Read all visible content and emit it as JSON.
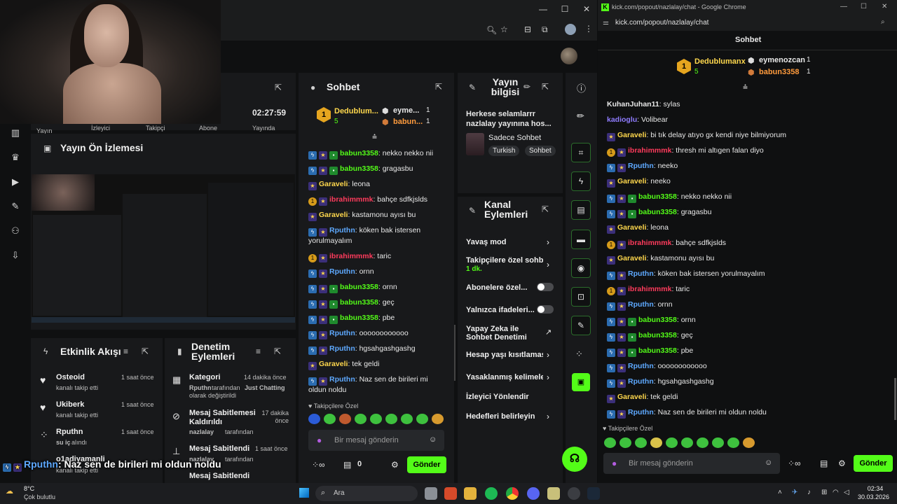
{
  "left_window": {
    "tab_title": "",
    "address": ""
  },
  "stats": {
    "timer": "02:27:59",
    "labels": [
      "Yayın",
      "İzleyici",
      "Takipçi",
      "Abone",
      "Yayında"
    ]
  },
  "preview": {
    "title": "Yayın Ön İzlemesi"
  },
  "activity": {
    "title": "Etkinlik Akışı",
    "items": [
      {
        "name": "Osteoid",
        "sub": "kanalı takip etti",
        "time": "1 saat önce"
      },
      {
        "name": "Ukiberk",
        "sub": "kanalı takip etti",
        "time": "1 saat önce"
      },
      {
        "name": "Rputhn",
        "sub_green": "su iç",
        "sub": "alındı",
        "time": "1 saat önce"
      },
      {
        "name": "o1adiyamanli",
        "sub": "kanalı takip etti",
        "time": ""
      }
    ]
  },
  "moderation": {
    "title": "Denetim Eylemleri",
    "items": [
      {
        "name": "Kategori",
        "time": "14 dakika önce",
        "user": "Rputhn",
        "mid": "tarafından",
        "target": "Just Chatting",
        "sub": "olarak değiştirildi"
      },
      {
        "name": "Mesaj Sabitlemesi Kaldırıldı",
        "time": "17 dakika önce",
        "user": "nazlalay",
        "sub": "tarafından"
      },
      {
        "name": "Mesaj Sabitlendi",
        "time": "1 saat önce",
        "user": "nazlalay",
        "sub": "tarafından"
      },
      {
        "name": "Mesaj Sabitlendi",
        "time": "",
        "user": "",
        "sub": ""
      }
    ]
  },
  "chat": {
    "title": "Sohbet",
    "leader1": {
      "name": "Dedublum...",
      "count": "5"
    },
    "leader2": {
      "name": "eyme...",
      "count": "1"
    },
    "leader3": {
      "name": "babun...",
      "count": "1"
    },
    "messages": [
      {
        "badges": [
          "bolt",
          "star",
          "sub"
        ],
        "user": "babun3358",
        "color": "green",
        "text": "nekko nekko nii"
      },
      {
        "badges": [
          "bolt",
          "star",
          "sub"
        ],
        "user": "babun3358",
        "color": "green",
        "text": "gragasbu"
      },
      {
        "badges": [
          "star"
        ],
        "user": "Garaveli",
        "color": "yellow",
        "text": "leona"
      },
      {
        "badges": [
          "gold",
          "star"
        ],
        "user": "ibrahimmmk",
        "color": "red",
        "text": "bahçe sdfkjslds"
      },
      {
        "badges": [
          "star"
        ],
        "user": "Garaveli",
        "color": "yellow",
        "text": "kastamonu ayısı bu"
      },
      {
        "badges": [
          "bolt",
          "star"
        ],
        "user": "Rputhn",
        "color": "blue",
        "text": "köken bak istersen",
        "text2": "yorulmayalım"
      },
      {
        "badges": [
          "gold",
          "star"
        ],
        "user": "ibrahimmmk",
        "color": "red",
        "text": "taric"
      },
      {
        "badges": [
          "bolt",
          "star"
        ],
        "user": "Rputhn",
        "color": "blue",
        "text": "ornn"
      },
      {
        "badges": [
          "bolt",
          "star",
          "sub"
        ],
        "user": "babun3358",
        "color": "green",
        "text": "ornn"
      },
      {
        "badges": [
          "bolt",
          "star",
          "sub"
        ],
        "user": "babun3358",
        "color": "green",
        "text": "geç"
      },
      {
        "badges": [
          "bolt",
          "star",
          "sub"
        ],
        "user": "babun3358",
        "color": "green",
        "text": "pbe"
      },
      {
        "badges": [
          "bolt",
          "star"
        ],
        "user": "Rputhn",
        "color": "blue",
        "text": "oooooooooooo"
      },
      {
        "badges": [
          "bolt",
          "star"
        ],
        "user": "Rputhn",
        "color": "blue",
        "text": "hgsahgashgashg"
      },
      {
        "badges": [
          "star"
        ],
        "user": "Garaveli",
        "color": "yellow",
        "text": "tek geldi"
      },
      {
        "badges": [
          "bolt",
          "star"
        ],
        "user": "Rputhn",
        "color": "blue",
        "text": "Naz sen de birileri mi",
        "text2": "oldun noldu"
      }
    ],
    "followers_label": "Takipçilere Özel",
    "input_placeholder": "Bir mesaj gönderin",
    "send_label": "Gönder",
    "count": "0"
  },
  "stream_info": {
    "title": "Yayın bilgisi",
    "desc": "Herkese selamlarrr nazlalay yayınına hos...",
    "category": "Sadece Sohbet",
    "tags": [
      "Turkish",
      "Sohbet"
    ]
  },
  "channel_actions": {
    "title": "Kanal Eylemleri",
    "rows": [
      {
        "label": "Yavaş mod",
        "type": "chevron"
      },
      {
        "label": "Takipçilere özel sohbe",
        "sub": "1 dk.",
        "type": "chevron"
      },
      {
        "label": "Abonelere özel...",
        "type": "toggle"
      },
      {
        "label": "Yalnızca ifadeleri...",
        "type": "toggle"
      },
      {
        "label": "Yapay Zeka ile Sohbet Denetimi",
        "type": "external"
      },
      {
        "label": "Hesap yaşı kısıtlaması",
        "type": "chevron"
      },
      {
        "label": "Yasaklanmış kelimeler",
        "type": "chevron"
      },
      {
        "label": "İzleyici Yönlendir",
        "type": "none"
      },
      {
        "label": "Hedefleri belirleyin",
        "type": "chevron"
      }
    ]
  },
  "overlay_message": {
    "user": "Rputhn",
    "text": ": Naz sen de birileri mi oldun noldu"
  },
  "right_window": {
    "tab_title": "kick.com/popout/nazlalay/chat - Google Chrome",
    "address": "kick.com/popout/nazlalay/chat",
    "chat_title": "Sohbet",
    "leader1": {
      "name": "Dedublumanx",
      "count": "5"
    },
    "leader2": {
      "name": "eymenozcan",
      "count": "1"
    },
    "leader3": {
      "name": "babun3358",
      "count": "1"
    },
    "messages": [
      {
        "badges": [],
        "user": "KuhanJuhan11",
        "color": "white",
        "text": "sylas"
      },
      {
        "badges": [],
        "user": "kadioglu",
        "color": "purple",
        "text": "Volibear"
      },
      {
        "badges": [
          "star"
        ],
        "user": "Garaveli",
        "color": "yellow",
        "text": "bi tık delay atıyo gx kendi niye bilmiyorum"
      },
      {
        "badges": [
          "gold",
          "star"
        ],
        "user": "ibrahimmmk",
        "color": "red",
        "text": "thresh mi altıgen falan diyo"
      },
      {
        "badges": [
          "bolt",
          "star"
        ],
        "user": "Rputhn",
        "color": "blue",
        "text": "neeko"
      },
      {
        "badges": [
          "star"
        ],
        "user": "Garaveli",
        "color": "yellow",
        "text": "neeko"
      },
      {
        "badges": [
          "bolt",
          "star",
          "sub"
        ],
        "user": "babun3358",
        "color": "green",
        "text": "nekko nekko nii"
      },
      {
        "badges": [
          "bolt",
          "star",
          "sub"
        ],
        "user": "babun3358",
        "color": "green",
        "text": "gragasbu"
      },
      {
        "badges": [
          "star"
        ],
        "user": "Garaveli",
        "color": "yellow",
        "text": "leona"
      },
      {
        "badges": [
          "gold",
          "star"
        ],
        "user": "ibrahimmmk",
        "color": "red",
        "text": "bahçe sdfkjslds"
      },
      {
        "badges": [
          "star"
        ],
        "user": "Garaveli",
        "color": "yellow",
        "text": "kastamonu ayısı bu"
      },
      {
        "badges": [
          "bolt",
          "star"
        ],
        "user": "Rputhn",
        "color": "blue",
        "text": "köken bak istersen yorulmayalım"
      },
      {
        "badges": [
          "gold",
          "star"
        ],
        "user": "ibrahimmmk",
        "color": "red",
        "text": "taric"
      },
      {
        "badges": [
          "bolt",
          "star"
        ],
        "user": "Rputhn",
        "color": "blue",
        "text": "ornn"
      },
      {
        "badges": [
          "bolt",
          "star",
          "sub"
        ],
        "user": "babun3358",
        "color": "green",
        "text": "ornn"
      },
      {
        "badges": [
          "bolt",
          "star",
          "sub"
        ],
        "user": "babun3358",
        "color": "green",
        "text": "geç"
      },
      {
        "badges": [
          "bolt",
          "star",
          "sub"
        ],
        "user": "babun3358",
        "color": "green",
        "text": "pbe"
      },
      {
        "badges": [
          "bolt",
          "star"
        ],
        "user": "Rputhn",
        "color": "blue",
        "text": "oooooooooooo"
      },
      {
        "badges": [
          "bolt",
          "star"
        ],
        "user": "Rputhn",
        "color": "blue",
        "text": "hgsahgashgashg"
      },
      {
        "badges": [
          "star"
        ],
        "user": "Garaveli",
        "color": "yellow",
        "text": "tek geldi"
      },
      {
        "badges": [
          "bolt",
          "star"
        ],
        "user": "Rputhn",
        "color": "blue",
        "text": "Naz sen de birileri mi oldun noldu"
      }
    ],
    "followers_label": "Takipçilere Özel",
    "input_placeholder": "Bir mesaj gönderin",
    "send_label": "Gönder"
  },
  "taskbar": {
    "weather_temp": "8°C",
    "weather_desc": "Çok bulutlu",
    "search_placeholder": "Ara",
    "time": "02:34",
    "date": "30.03.2026"
  },
  "colors": {
    "accent": "#53fc18",
    "panel": "#18191b",
    "bg": "#0f1011"
  }
}
